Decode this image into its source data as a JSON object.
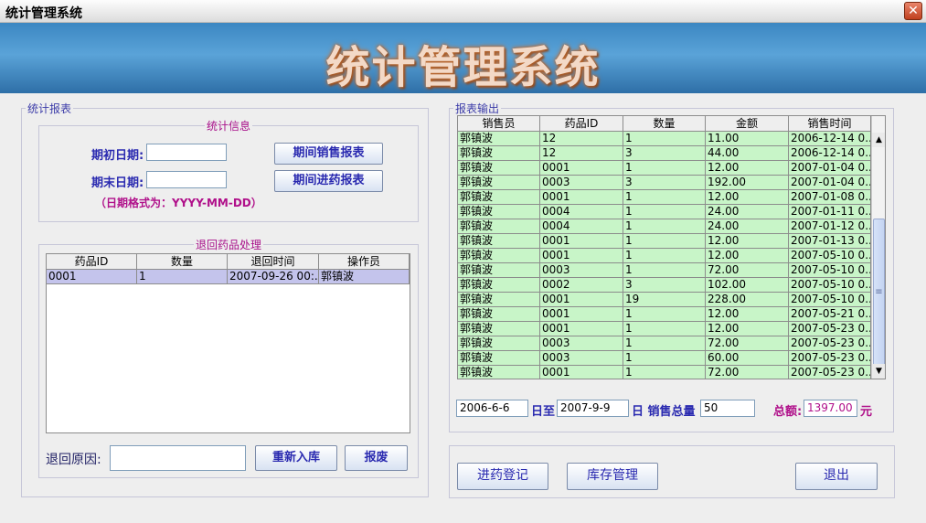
{
  "window": {
    "title": "统计管理系统",
    "close": "✕"
  },
  "banner": {
    "title": "统计管理系统"
  },
  "left_panel": {
    "legend": "统计报表",
    "stats": {
      "legend": "统计信息",
      "start_label": "期初日期:",
      "end_label": "期末日期:",
      "start_value": "",
      "end_value": "",
      "hint": "（日期格式为：YYYY-MM-DD）",
      "sales_report_button": "期间销售报表",
      "purchase_report_button": "期间进药报表"
    },
    "returns": {
      "legend": "退回药品处理",
      "columns": [
        "药品ID",
        "数量",
        "退回时间",
        "操作员"
      ],
      "rows": [
        [
          "0001",
          "1",
          "2007-09-26 00:...",
          "郭镇波"
        ]
      ],
      "reason_label": "退回原因:",
      "reason_value": "",
      "restock_button": "重新入库",
      "scrap_button": "报废"
    }
  },
  "right_panel": {
    "legend": "报表输出",
    "columns": [
      "销售员",
      "药品ID",
      "数量",
      "金额",
      "销售时间"
    ],
    "rows": [
      [
        "郭镇波",
        "12",
        "1",
        "11.00",
        "2006-12-14 0..."
      ],
      [
        "郭镇波",
        "12",
        "3",
        "44.00",
        "2006-12-14 0..."
      ],
      [
        "郭镇波",
        "0001",
        "1",
        "12.00",
        "2007-01-04 0..."
      ],
      [
        "郭镇波",
        "0003",
        "3",
        "192.00",
        "2007-01-04 0..."
      ],
      [
        "郭镇波",
        "0001",
        "1",
        "12.00",
        "2007-01-08 0..."
      ],
      [
        "郭镇波",
        "0004",
        "1",
        "24.00",
        "2007-01-11 0..."
      ],
      [
        "郭镇波",
        "0004",
        "1",
        "24.00",
        "2007-01-12 0..."
      ],
      [
        "郭镇波",
        "0001",
        "1",
        "12.00",
        "2007-01-13 0..."
      ],
      [
        "郭镇波",
        "0001",
        "1",
        "12.00",
        "2007-05-10 0..."
      ],
      [
        "郭镇波",
        "0003",
        "1",
        "72.00",
        "2007-05-10 0..."
      ],
      [
        "郭镇波",
        "0002",
        "3",
        "102.00",
        "2007-05-10 0..."
      ],
      [
        "郭镇波",
        "0001",
        "19",
        "228.00",
        "2007-05-10 0..."
      ],
      [
        "郭镇波",
        "0001",
        "1",
        "12.00",
        "2007-05-21 0..."
      ],
      [
        "郭镇波",
        "0001",
        "1",
        "12.00",
        "2007-05-23 0..."
      ],
      [
        "郭镇波",
        "0003",
        "1",
        "72.00",
        "2007-05-23 0..."
      ],
      [
        "郭镇波",
        "0003",
        "1",
        "60.00",
        "2007-05-23 0..."
      ],
      [
        "郭镇波",
        "0001",
        "1",
        "72.00",
        "2007-05-23 0..."
      ]
    ],
    "summary": {
      "from_value": "2006-6-6",
      "to_label": "日至",
      "to_value": "2007-9-9",
      "day_sales_label": "日 销售总量",
      "sales_total": "50",
      "amount_label": "总额:",
      "amount_value": "1397.00",
      "currency": "元"
    }
  },
  "bottom_bar": {
    "purchase_button": "进药登记",
    "inventory_button": "库存管理",
    "exit_button": "退出"
  },
  "colors": {
    "accent": "#2a2ab0",
    "magenta": "#b0108a",
    "row_green": "#c8f5c8",
    "row_selected": "#c4c4ec",
    "banner": "#3c87c2"
  }
}
